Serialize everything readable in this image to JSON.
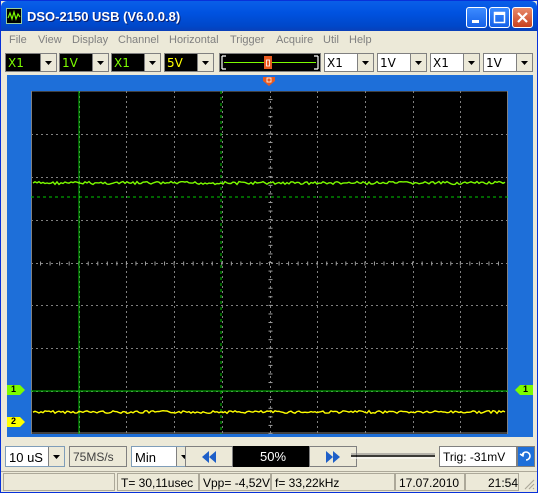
{
  "window": {
    "title": "DSO-2150 USB (V6.0.0.8)"
  },
  "menu": [
    "File",
    "View",
    "Display",
    "Channel",
    "Horizontal",
    "Trigger",
    "Acquire",
    "Util",
    "Help"
  ],
  "toolbar": {
    "ch1_probe": "X1",
    "ch1_volts": "1V",
    "ch2_probe": "X1",
    "ch2_volts": "5V",
    "math_probe": "X1",
    "math_volts": "1V",
    "ref_probe": "X1",
    "ref_volts": "1V"
  },
  "markers": {
    "ch1": "1",
    "ch2": "2"
  },
  "bottom": {
    "timebase": "10 uS",
    "sample_rate": "75MS/s",
    "acq_mode": "Min",
    "trigger_position": "50%",
    "trigger_level": "Trig: -31mV"
  },
  "status": {
    "time": "T= 30,11usec",
    "vpp": "Vpp= -4,52V",
    "freq": "f= 33,22kHz",
    "date": "17.07.2010",
    "clock": "21:54"
  },
  "colors": {
    "ch1": "#7CFC00",
    "ch2": "#FFFF00",
    "scope_bg": "#000000",
    "grid": "#808080",
    "frame": "#1E6FD9"
  }
}
